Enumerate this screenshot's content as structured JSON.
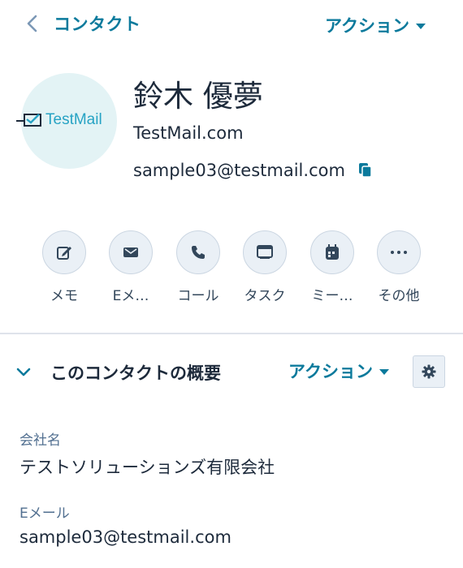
{
  "header": {
    "back_label": "コンタクト",
    "actions_label": "アクション"
  },
  "contact": {
    "logo_part1": "TestMail",
    "logo_part2": "",
    "name": "鈴木 優夢",
    "company_domain": "TestMail.com",
    "email": "sample03@testmail.com"
  },
  "quick_actions": [
    {
      "label": "メモ",
      "icon": "edit-icon"
    },
    {
      "label": "Eメ…",
      "icon": "mail-icon"
    },
    {
      "label": "コール",
      "icon": "phone-icon"
    },
    {
      "label": "タスク",
      "icon": "task-icon"
    },
    {
      "label": "ミー…",
      "icon": "calendar-icon"
    },
    {
      "label": "その他",
      "icon": "more-icon"
    }
  ],
  "about_section": {
    "title": "このコンタクトの概要",
    "actions_label": "アクション",
    "properties": [
      {
        "label": "会社名",
        "value": "テストソリューションズ有限会社"
      },
      {
        "label": "Eメール",
        "value": "sample03@testmail.com"
      }
    ]
  },
  "colors": {
    "accent": "#0b7a9c",
    "text": "#1d2a3b",
    "button_bg": "#eaf0f6",
    "avatar_bg": "#e3f3f5"
  }
}
